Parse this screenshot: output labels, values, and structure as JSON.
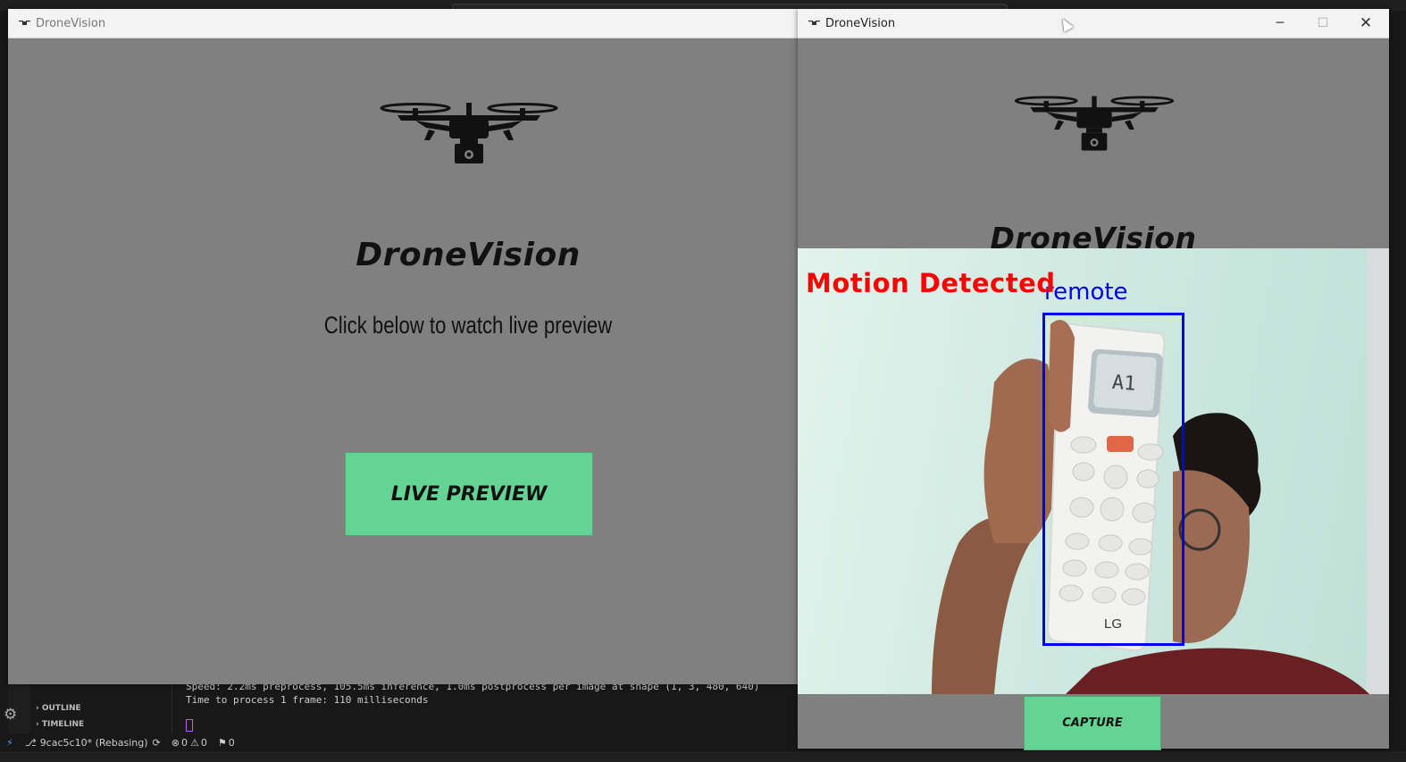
{
  "left_window": {
    "title": "DroneVision",
    "app_title": "DroneVision",
    "subtitle": "Click below to watch live preview",
    "button_label": "LIVE PREVIEW"
  },
  "right_window": {
    "title": "DroneVision",
    "app_title": "DroneVision",
    "overlay_text": "Motion Detected",
    "detection_label": "remote",
    "capture_label": "CAPTURE",
    "remote_display": "A1",
    "remote_brand": "LG",
    "colors": {
      "overlay": "#ff0000",
      "box": "#0000ee",
      "button": "#63d493"
    }
  },
  "vscode": {
    "terminal_line1": "Speed: 2.2ms preprocess, 105.5ms inference, 1.0ms postprocess per image at shape (1, 3, 480, 640)",
    "terminal_line2": "Time to process 1 frame: 110 milliseconds",
    "sidebar_outline": "OUTLINE",
    "sidebar_timeline": "TIMELINE",
    "branch": "9cac5c10* (Rebasing)",
    "errors": "0",
    "warnings": "0",
    "ports": "0"
  }
}
